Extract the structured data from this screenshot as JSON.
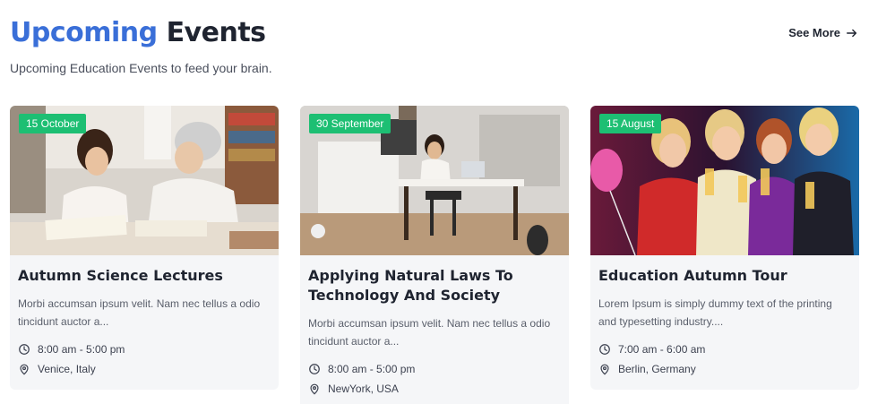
{
  "section": {
    "title_accent": "Upcoming",
    "title_rest": "Events",
    "subtitle": "Upcoming Education Events to feed your brain.",
    "see_more_label": "See More"
  },
  "colors": {
    "accent_blue": "#3a6fd8",
    "badge_green": "#1dbf73"
  },
  "events": [
    {
      "date": "15 October",
      "title": "Autumn Science Lectures",
      "description": "Morbi accumsan ipsum velit. Nam nec tellus a odio tincidunt auctor a...",
      "time": "8:00 am - 5:00 pm",
      "location": "Venice, Italy",
      "image": "two-people-reading-books"
    },
    {
      "date": "30 September",
      "title": "Applying Natural Laws To Technology And Society",
      "description": "Morbi accumsan ipsum velit. Nam nec tellus a odio tincidunt auctor a...",
      "time": "8:00 am - 5:00 pm",
      "location": "NewYork, USA",
      "image": "person-at-desk-with-laptop"
    },
    {
      "date": "15 August",
      "title": "Education Autumn Tour",
      "description": "Lorem Ipsum is simply dummy text of the printing and typesetting industry....",
      "time": "7:00 am - 6:00 am",
      "location": "Berlin, Germany",
      "image": "women-celebrating-with-champagne"
    }
  ],
  "icons": {
    "time": "clock-icon",
    "location": "map-pin-icon",
    "see_more": "arrow-right-icon"
  }
}
